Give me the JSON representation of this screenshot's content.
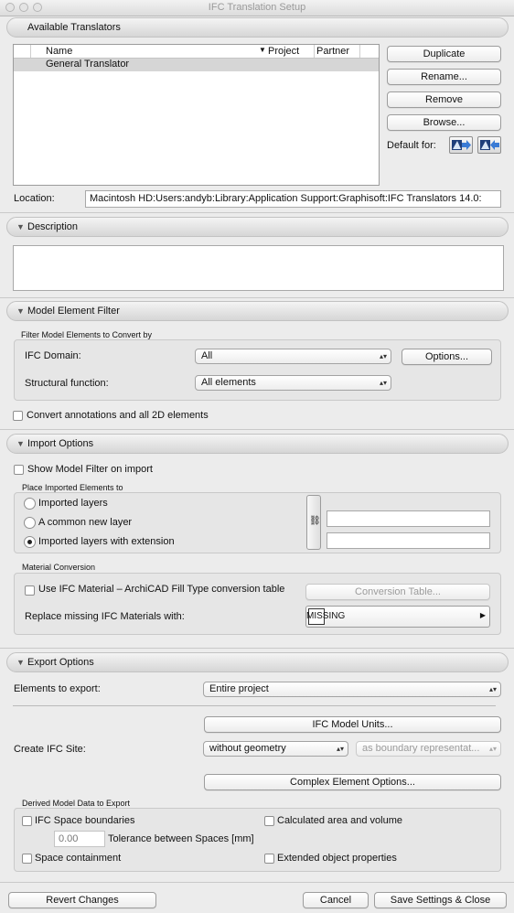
{
  "window": {
    "title": "IFC Translation Setup"
  },
  "available_translators": {
    "header": "Available Translators",
    "columns": {
      "name": "Name",
      "project": "Project",
      "partner": "Partner"
    },
    "rows": [
      {
        "name": "General Translator"
      }
    ],
    "buttons": {
      "duplicate": "Duplicate",
      "rename": "Rename...",
      "remove": "Remove",
      "browse": "Browse..."
    },
    "default_for_label": "Default for:",
    "location_label": "Location:",
    "location_value": "Macintosh HD:Users:andyb:Library:Application Support:Graphisoft:IFC Translators 14.0:"
  },
  "description": {
    "header": "Description",
    "value": ""
  },
  "model_element_filter": {
    "header": "Model Element Filter",
    "group_label": "Filter Model Elements to Convert by",
    "ifc_domain_label": "IFC Domain:",
    "ifc_domain_value": "All",
    "options_button": "Options...",
    "structural_label": "Structural function:",
    "structural_value": "All elements",
    "convert_annotations": "Convert annotations and all 2D elements"
  },
  "import_options": {
    "header": "Import Options",
    "show_filter": "Show Model Filter on import",
    "place_group_label": "Place Imported Elements to",
    "radios": [
      "Imported layers",
      "A common new layer",
      "Imported layers with extension"
    ],
    "selected_radio": 2,
    "material_group_label": "Material Conversion",
    "use_material": "Use IFC Material – ArchiCAD Fill Type conversion table",
    "conversion_table_button": "Conversion Table...",
    "replace_label": "Replace missing IFC Materials with:",
    "replace_value": "MISSING"
  },
  "export_options": {
    "header": "Export Options",
    "elements_label": "Elements to export:",
    "elements_value": "Entire project",
    "units_button": "IFC Model Units...",
    "site_label": "Create IFC Site:",
    "site_value": "without geometry",
    "site_rep_value": "as boundary representat...",
    "complex_button": "Complex Element Options...",
    "derived_group_label": "Derived Model Data to Export",
    "space_boundaries": "IFC Space boundaries",
    "calculated_area": "Calculated area and volume",
    "tolerance_value": "0.00",
    "tolerance_label": "Tolerance between Spaces [mm]",
    "space_containment": "Space containment",
    "extended_props": "Extended object properties"
  },
  "footer": {
    "revert": "Revert Changes",
    "cancel": "Cancel",
    "save": "Save Settings & Close"
  }
}
